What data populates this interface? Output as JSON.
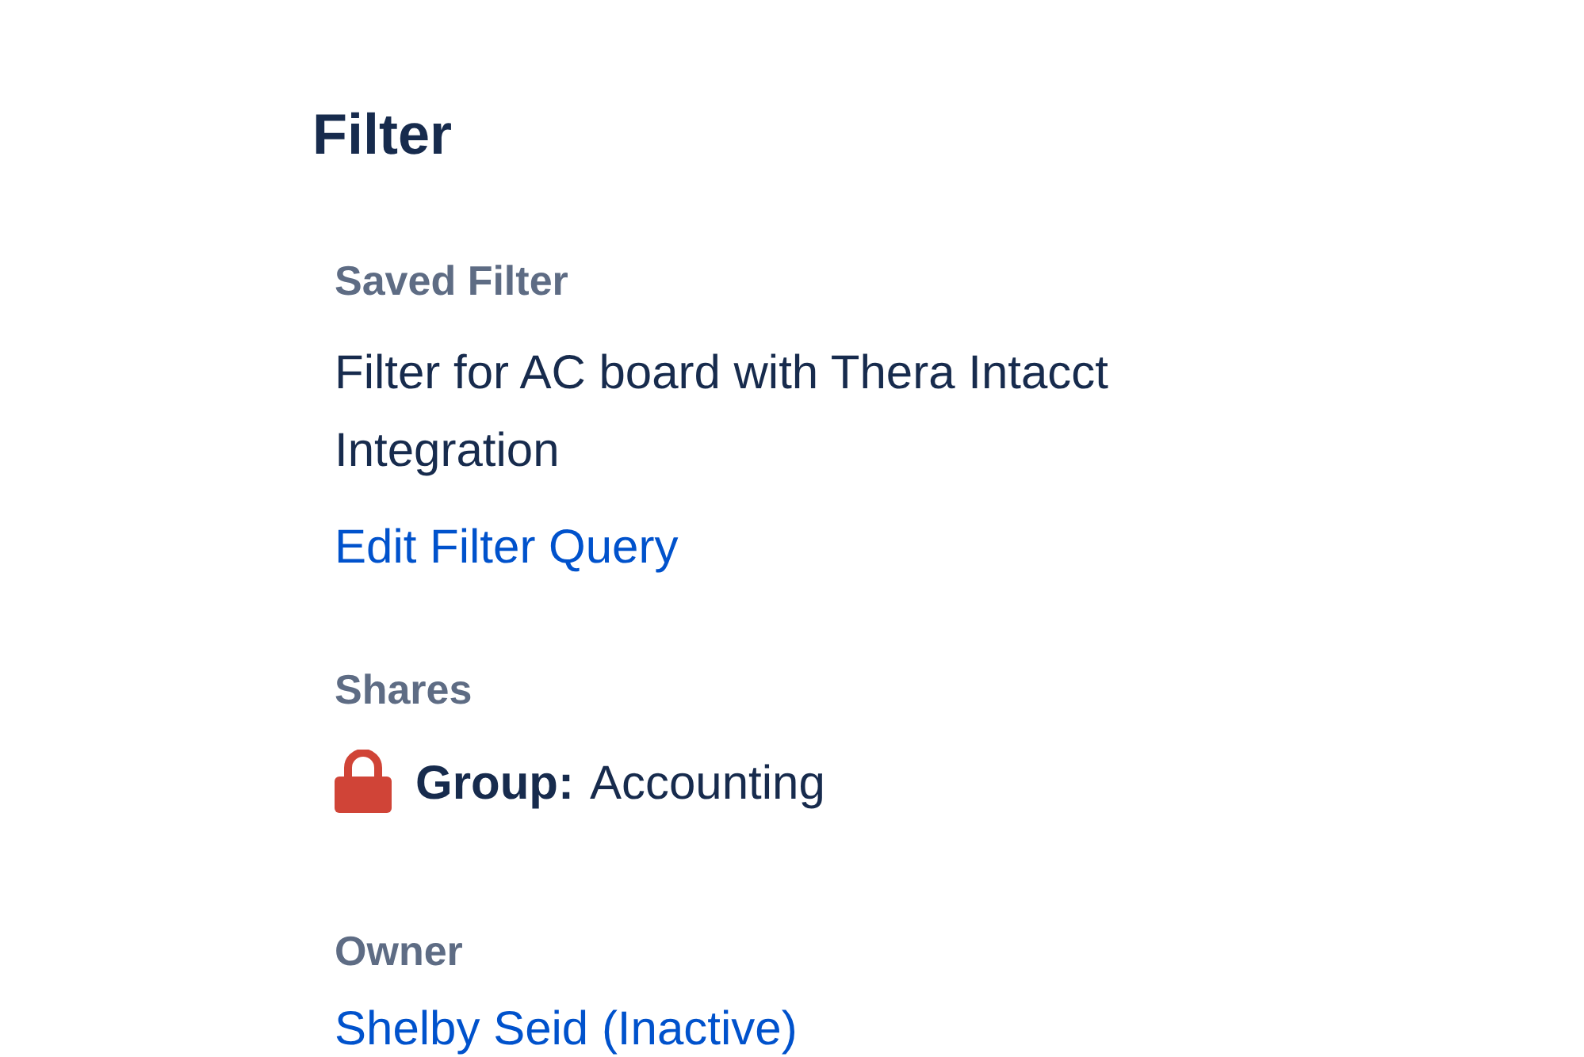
{
  "heading": "Filter",
  "fields": [
    {
      "kind": "text",
      "label": "Saved Filter",
      "value": "Filter for AC board with Thera Intacct Integration",
      "link": "Edit Filter Query"
    },
    {
      "kind": "shares",
      "label": "Shares",
      "shares": [
        {
          "type": "Group:",
          "name": "Accounting"
        }
      ]
    },
    {
      "kind": "link",
      "label": "Owner",
      "value": "Shelby Seid (Inactive)"
    }
  ]
}
